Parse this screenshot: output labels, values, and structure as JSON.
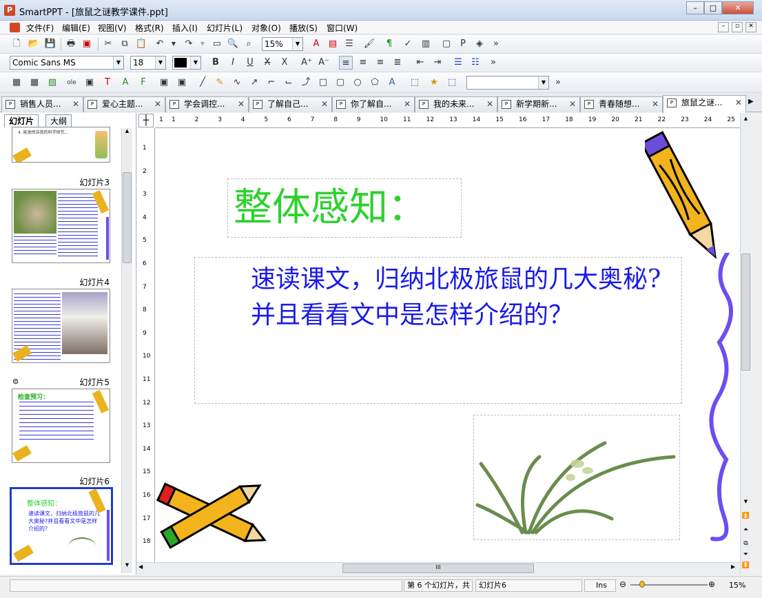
{
  "window": {
    "app": "SmartPPT",
    "title": "SmartPPT - [旅鼠之谜教学课件.ppt]",
    "minimize": "–",
    "maximize": "□",
    "close": "✕"
  },
  "menu": [
    "文件(F)",
    "编辑(E)",
    "视图(V)",
    "格式(R)",
    "插入(I)",
    "幻灯片(L)",
    "对象(O)",
    "播放(S)",
    "窗口(W)"
  ],
  "toolbar1": {
    "zoom": "15%",
    "more": "»"
  },
  "toolbar2": {
    "font": "Comic Sans MS",
    "size": "18",
    "more": "»"
  },
  "toolbar3": {
    "more": "»"
  },
  "tabs": [
    "销售人员...",
    "爱心主题...",
    "学会调控...",
    "了解自己...",
    "你了解自...",
    "我的未来...",
    "新学期新...",
    "青春随想...",
    "旅鼠之谜..."
  ],
  "panel": {
    "tab_slides": "幻灯片",
    "tab_outline": "大纲",
    "labels": [
      "幻灯片3",
      "幻灯片4",
      "幻灯片5",
      "幻灯片6"
    ],
    "thumb6_title": "整体感知：",
    "thumb6_body": "速读课文，归纳北极旅鼠的几大奥秘?并且看看文中是怎样介绍的？",
    "thumb5_title": "检查预习："
  },
  "ruler_h": [
    "1",
    "1",
    "2",
    "3",
    "4",
    "5",
    "6",
    "7",
    "8",
    "9",
    "10",
    "11",
    "12",
    "13",
    "14",
    "15",
    "16",
    "17",
    "18",
    "19",
    "20",
    "21",
    "22",
    "23",
    "24",
    "25"
  ],
  "ruler_v": [
    "1",
    "2",
    "3",
    "4",
    "5",
    "6",
    "7",
    "8",
    "9",
    "10",
    "11",
    "12",
    "13",
    "14",
    "15",
    "16",
    "17",
    "18"
  ],
  "slide": {
    "title": "整体感知：",
    "body": "速读课文，归纳北极旅鼠的几大奥秘?并且看看文中是怎样介绍的？",
    "title_color": "#2ed12e",
    "body_color": "#1a1ae6"
  },
  "status": {
    "slide_count": "第 6 个幻灯片，共",
    "slide_name": "幻灯片6",
    "mode": "Ins",
    "zoom": "15%"
  }
}
